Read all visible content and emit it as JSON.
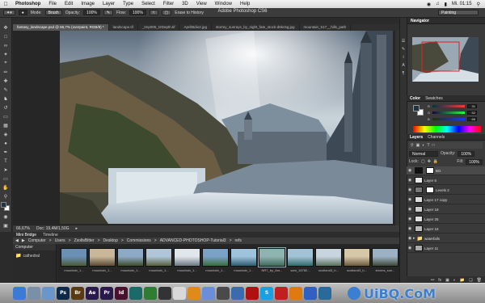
{
  "menubar": {
    "app": "Photoshop",
    "items": [
      "File",
      "Edit",
      "Image",
      "Layer",
      "Type",
      "Select",
      "Filter",
      "3D",
      "View",
      "Window",
      "Help"
    ],
    "clock": "Mi. 01:15"
  },
  "window_title": "Adobe Photoshop CS6",
  "options": {
    "mode_label": "Mode:",
    "mode_value": "Brush",
    "opacity_label": "Opacity:",
    "opacity_value": "100%",
    "flow_label": "Flow:",
    "flow_value": "100%",
    "erase_label": "Erase to History",
    "workspace": "Painting"
  },
  "tabs": [
    "fantasy_landscape.psd @ 66,7% (overpaint, RGB/8) *",
    "landscape.tif",
    "_tmp005_t2Depth.tif",
    "April5tdio2.jpg",
    "stormy_sunrays_by_night_fate_stock-d6kc5g.jpg",
    "mountain_517__hills_path"
  ],
  "status": {
    "zoom": "66,67%",
    "doc": "Doc: 19,4M/1,50G"
  },
  "panels": {
    "navigator_title": "Navigator",
    "color_tab": "Color",
    "swatches_tab": "Swatches",
    "layers_tab": "Layers",
    "channels_tab": "Channels",
    "blend_mode": "Normal",
    "opacity_label": "Opacity:",
    "opacity_value": "100%",
    "lock_label": "Lock:",
    "fill_label": "Fill:",
    "fill_value": "100%",
    "rgb": {
      "r": "31",
      "g": "52",
      "b": "66"
    },
    "color_labels": [
      "R",
      "G",
      "B"
    ]
  },
  "layers": [
    {
      "name": "BG",
      "thumb": "#111111"
    },
    {
      "name": "Layer 6",
      "thumb": "#e8e8e8"
    },
    {
      "name": "Levels 2",
      "thumb": "#777777"
    },
    {
      "name": "Layer 17 copy",
      "thumb": "#dddddd"
    },
    {
      "name": "Layer 18",
      "thumb": "#cccccc"
    },
    {
      "name": "Layer 25",
      "thumb": "#e0e0e0"
    },
    {
      "name": "Layer 16",
      "thumb": "#bbbbbb"
    },
    {
      "name": "waterfalls",
      "thumb": "#888888"
    },
    {
      "name": "Layer 11",
      "thumb": "#aaaaaa"
    }
  ],
  "bridge": {
    "tabs": [
      "Mini Bridge",
      "Timeline"
    ],
    "path": [
      "Computer",
      "Users",
      "ZsoltsBitter",
      "Desktop",
      "Commissions",
      "ADVANCED-PHOTOSHOP-Tutorial3",
      "refs"
    ],
    "side_title": "Computer",
    "side_item": "cathedral",
    "thumbs": [
      {
        "label": "mountain_1...",
        "c1": "#6b8fb5",
        "c2": "#4a5a38"
      },
      {
        "label": "mountain_1...",
        "c1": "#c9b79a",
        "c2": "#5a4a33"
      },
      {
        "label": "mountain_1...",
        "c1": "#8ea9c6",
        "c2": "#3d4d2a"
      },
      {
        "label": "mountain_1...",
        "c1": "#b0c6d8",
        "c2": "#55603e"
      },
      {
        "label": "mountain_1...",
        "c1": "#e0e6ea",
        "c2": "#6a7680"
      },
      {
        "label": "mountain_1...",
        "c1": "#7aa2c9",
        "c2": "#3a6b3a"
      },
      {
        "label": "mountain_1...",
        "c1": "#9ec3db",
        "c2": "#2f5b6e"
      },
      {
        "label": "NR7_by_Ars...",
        "c1": "#8fb3b0",
        "c2": "#3e6a5a"
      },
      {
        "label": "sam_18782...",
        "c1": "#a4c2d6",
        "c2": "#2f6a6a"
      },
      {
        "label": "scotland3_b...",
        "c1": "#c8d4de",
        "c2": "#58705a"
      },
      {
        "label": "scotland3_b...",
        "c1": "#d5c7a8",
        "c2": "#6b5a3a"
      },
      {
        "label": "storms_sun...",
        "c1": "#9cb1c4",
        "c2": "#3c4a38"
      }
    ]
  },
  "dock": [
    {
      "name": "finder",
      "label": "",
      "color": "#3a7bd5"
    },
    {
      "name": "preview",
      "label": "",
      "color": "#7a8fa8"
    },
    {
      "name": "mail",
      "label": "",
      "color": "#6a96c8"
    },
    {
      "name": "photoshop",
      "label": "Ps",
      "color": "#0f2a47"
    },
    {
      "name": "bridge",
      "label": "Br",
      "color": "#5a3a14"
    },
    {
      "name": "after-effects",
      "label": "Ae",
      "color": "#2a1a4a"
    },
    {
      "name": "premiere",
      "label": "Pr",
      "color": "#2a1a4a"
    },
    {
      "name": "indesign",
      "label": "Id",
      "color": "#4a1030"
    },
    {
      "name": "app-teal",
      "label": "",
      "color": "#1a6a6a"
    },
    {
      "name": "app-green",
      "label": "",
      "color": "#2e7d32"
    },
    {
      "name": "app-pattern",
      "label": "",
      "color": "#333333"
    },
    {
      "name": "chrome",
      "label": "",
      "color": "#d9d9d9"
    },
    {
      "name": "app-orange",
      "label": "",
      "color": "#e08a1a"
    },
    {
      "name": "itunes",
      "label": "",
      "color": "#6a8fd8"
    },
    {
      "name": "app-gear",
      "label": "",
      "color": "#4a4a4a"
    },
    {
      "name": "app-globe",
      "label": "",
      "color": "#3a6ab0"
    },
    {
      "name": "filezilla",
      "label": "",
      "color": "#b01010"
    },
    {
      "name": "skype",
      "label": "S",
      "color": "#1aa0e0"
    },
    {
      "name": "app-red",
      "label": "",
      "color": "#c02020"
    },
    {
      "name": "app-orange2",
      "label": "",
      "color": "#e07a10"
    },
    {
      "name": "app-blue",
      "label": "",
      "color": "#3060c0"
    },
    {
      "name": "app-misc",
      "label": "",
      "color": "#2a6a9a"
    }
  ],
  "watermark": "UiBQ.CoM"
}
